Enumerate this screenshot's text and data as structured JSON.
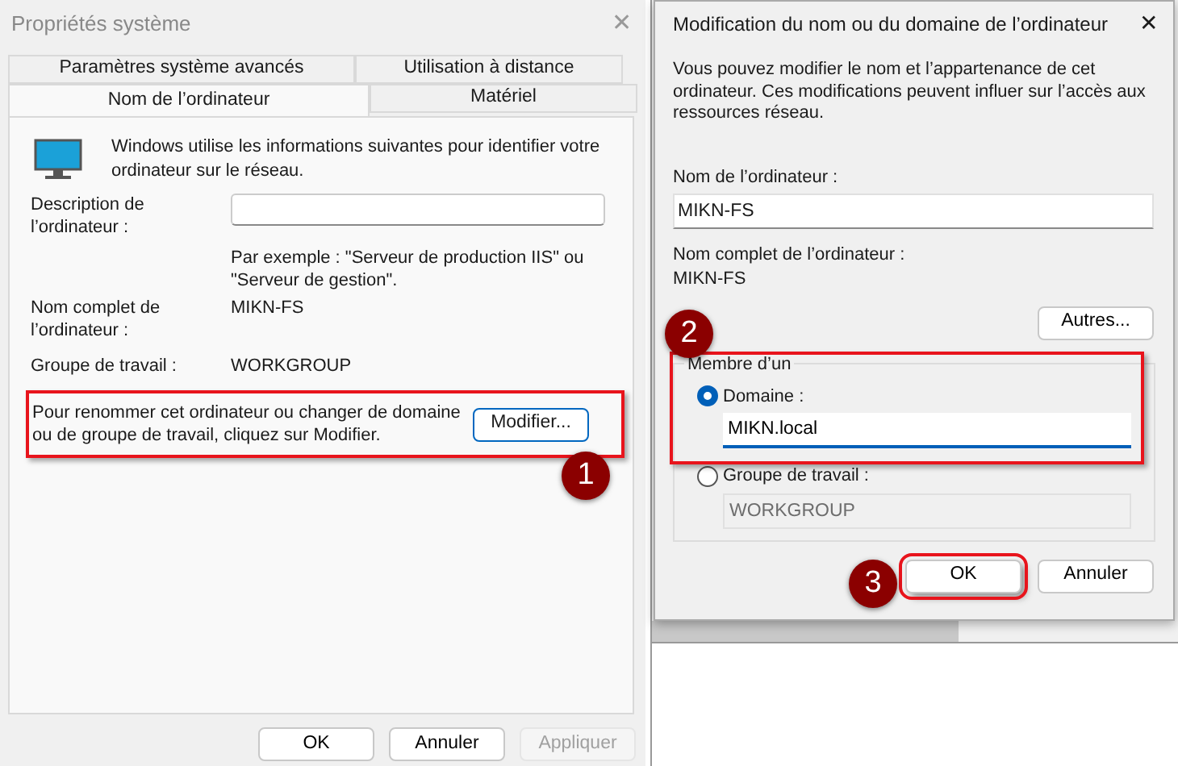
{
  "system_window": {
    "title": "Propriétés système",
    "close": "✕",
    "tab_rows": [
      [
        {
          "label": "Paramètres système avancés",
          "selected": false
        },
        {
          "label": "Utilisation à distance",
          "selected": false
        }
      ],
      [
        {
          "label": "Nom de l’ordinateur",
          "selected": true
        },
        {
          "label": "Matériel",
          "selected": false
        }
      ]
    ],
    "intro": "Windows utilise les informations suivantes pour identifier votre ordinateur sur le réseau.",
    "description_label": "Description de l’ordinateur :",
    "description_hint": "Par exemple : \"Serveur de production IIS\" ou \"Serveur de gestion\".",
    "info_rows": [
      {
        "label": "Nom complet de l’ordinateur :",
        "value": "MIKN-FS"
      },
      {
        "label": "Groupe de travail :",
        "value": "WORKGROUP"
      }
    ],
    "rename_text": "Pour renommer cet ordinateur ou changer de domaine ou de groupe de travail, cliquez sur Modifier.",
    "modify_button": "Modifier...",
    "buttons": [
      {
        "label": "OK",
        "disabled": false
      },
      {
        "label": "Annuler",
        "disabled": false
      },
      {
        "label": "Appliquer",
        "disabled": true
      }
    ]
  },
  "rename_dialog": {
    "title": "Modification du nom ou du domaine de l’ordinateur",
    "close": "✕",
    "intro": "Vous pouvez modifier le nom et l’appartenance de cet ordinateur. Ces modifications peuvent influer sur l’accès aux ressources réseau.",
    "name_label": "Nom de l’ordinateur :",
    "name_value": "MIKN-FS",
    "full_name_label": "Nom complet de l’ordinateur :",
    "full_name_value": "MIKN-FS",
    "more_button": "Autres...",
    "member_group": "Membre d’un",
    "options": [
      {
        "label": "Domaine :",
        "selected": true,
        "value": "MIKN.local"
      },
      {
        "label": "Groupe de travail :",
        "selected": false,
        "disabled_value": "WORKGROUP"
      }
    ],
    "buttons": [
      {
        "label": "OK",
        "highlighted": true
      },
      {
        "label": "Annuler",
        "highlighted": false
      }
    ]
  },
  "steps": [
    "1",
    "2",
    "3"
  ]
}
